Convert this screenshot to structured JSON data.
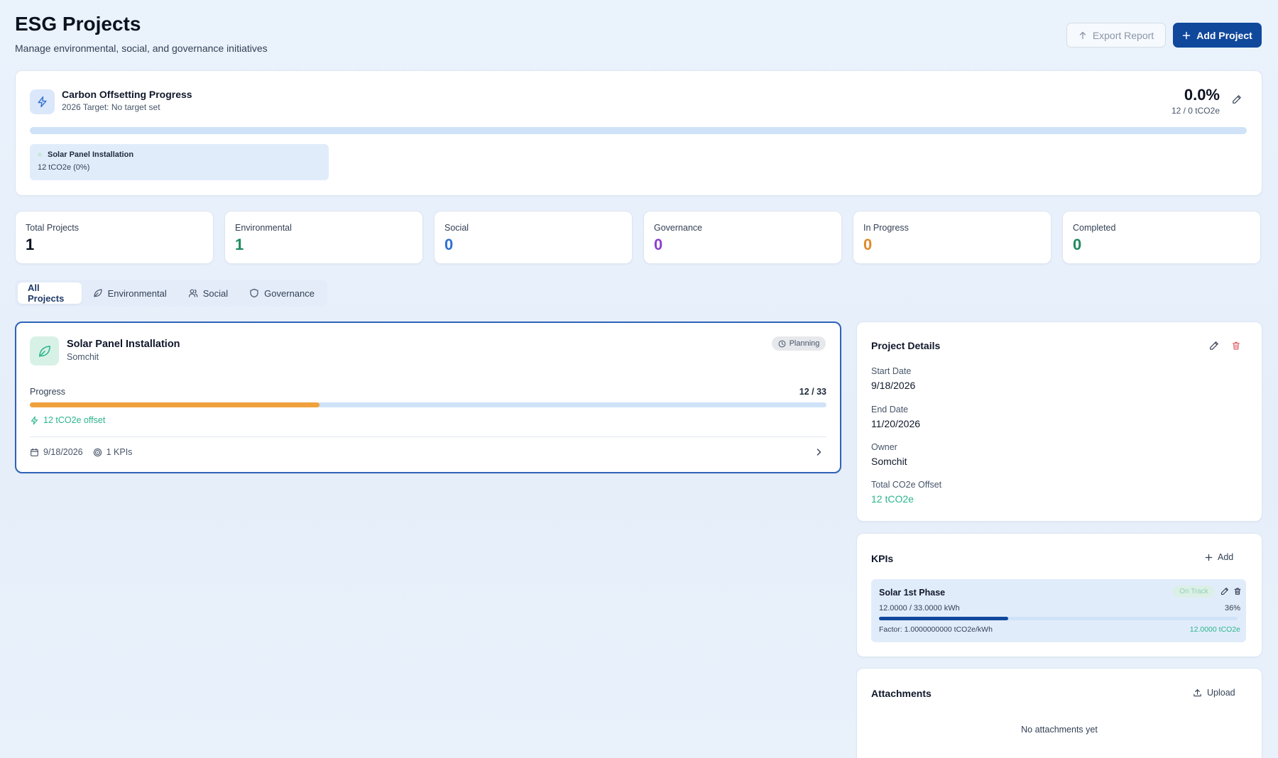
{
  "header": {
    "title": "ESG Projects",
    "subtitle": "Manage environmental, social, and governance initiatives",
    "export_label": "Export Report",
    "add_label": "Add Project"
  },
  "carbon": {
    "title": "Carbon Offsetting Progress",
    "target": "2026 Target: No target set",
    "percent": "0.0%",
    "ratio": "12 / 0 tCO2e",
    "progress": 0,
    "chip": {
      "name": "Solar Panel Installation",
      "value": "12 tCO2e (0%)"
    }
  },
  "stats": [
    {
      "label": "Total Projects",
      "value": "1",
      "color": "#0b1220"
    },
    {
      "label": "Environmental",
      "value": "1",
      "color": "#1f8a5e"
    },
    {
      "label": "Social",
      "value": "0",
      "color": "#2f6fd0"
    },
    {
      "label": "Governance",
      "value": "0",
      "color": "#8b3fd1"
    },
    {
      "label": "In Progress",
      "value": "0",
      "color": "#e0892a"
    },
    {
      "label": "Completed",
      "value": "0",
      "color": "#1f8a5e"
    }
  ],
  "tabs": [
    {
      "label": "All Projects",
      "icon": "none"
    },
    {
      "label": "Environmental",
      "icon": "leaf-icon"
    },
    {
      "label": "Social",
      "icon": "users-icon"
    },
    {
      "label": "Governance",
      "icon": "shield-icon"
    }
  ],
  "project": {
    "name": "Solar Panel Installation",
    "owner": "Somchit",
    "status": "Planning",
    "progress_label": "Progress",
    "progress_value": "12 / 33",
    "progress": 0.3636,
    "offset": "12 tCO2e offset",
    "date": "9/18/2026",
    "kpis": "1 KPIs"
  },
  "details": {
    "title": "Project Details",
    "start_label": "Start Date",
    "start_value": "9/18/2026",
    "end_label": "End Date",
    "end_value": "11/20/2026",
    "owner_label": "Owner",
    "owner_value": "Somchit",
    "offset_label": "Total CO2e Offset",
    "offset_value": "12 tCO2e"
  },
  "kpi": {
    "title": "KPIs",
    "add_label": "Add",
    "item": {
      "name": "Solar 1st Phase",
      "badge": "On Track",
      "numbers": "12.0000 / 33.0000 kWh",
      "percent": "36%",
      "progress": 0.36,
      "factor": "Factor: 1.0000000000 tCO2e/kWh",
      "total": "12.0000 tCO2e"
    }
  },
  "attachments": {
    "title": "Attachments",
    "upload_label": "Upload",
    "empty": "No attachments yet"
  },
  "colors": {
    "accent": "#10489c",
    "green": "#2bb58b",
    "orange": "#f0a13d"
  }
}
